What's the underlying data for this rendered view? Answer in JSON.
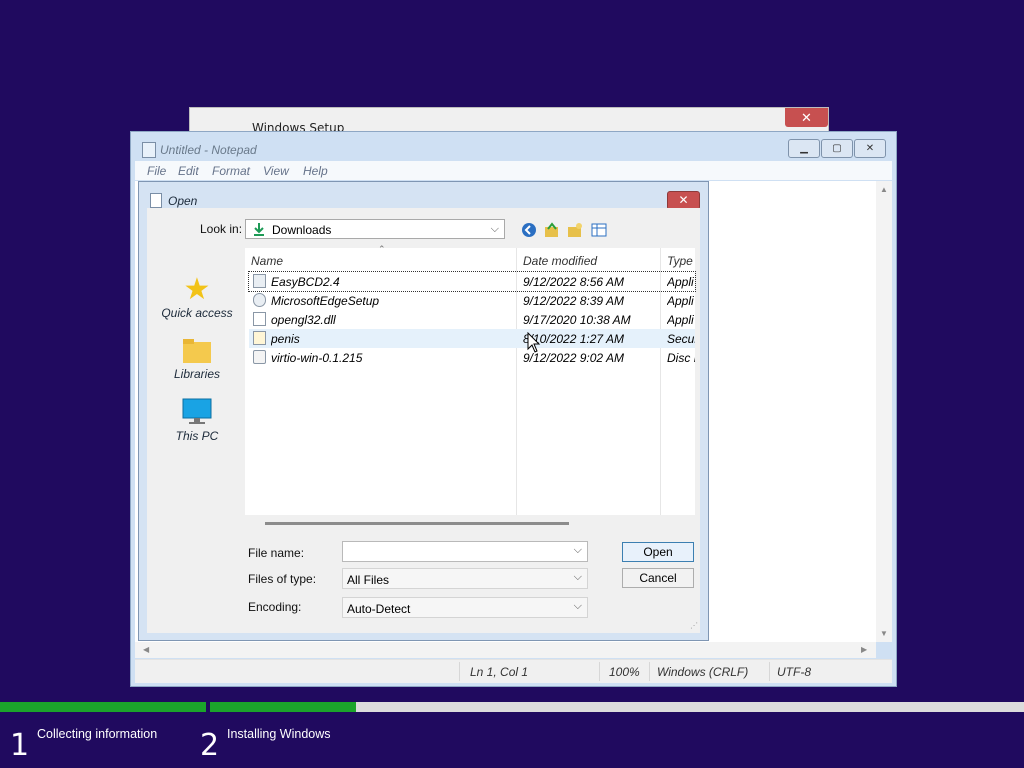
{
  "setup_window": {
    "title": "Windows Setup",
    "close_glyph": "✕"
  },
  "notepad": {
    "title": "Untitled - Notepad",
    "menu": [
      "File",
      "Edit",
      "Format",
      "View",
      "Help"
    ],
    "status": {
      "position": "Ln 1, Col 1",
      "zoom": "100%",
      "line_endings": "Windows (CRLF)",
      "encoding": "UTF-8"
    }
  },
  "open_dialog": {
    "title": "Open",
    "look_in_label": "Look in:",
    "look_in_value": "Downloads",
    "places": [
      "Quick access",
      "Libraries",
      "This PC"
    ],
    "columns": [
      "Name",
      "Date modified",
      "Type"
    ],
    "files": [
      {
        "name": "EasyBCD2.4",
        "date": "9/12/2022 8:56 AM",
        "type": "Appli"
      },
      {
        "name": "MicrosoftEdgeSetup",
        "date": "9/12/2022 8:39 AM",
        "type": "Appli"
      },
      {
        "name": "opengl32.dll",
        "date": "9/17/2020 10:38 AM",
        "type": "Appli"
      },
      {
        "name": "penis",
        "date": "8/10/2022 1:27 AM",
        "type": "Secur"
      },
      {
        "name": "virtio-win-0.1.215",
        "date": "9/12/2022 9:02 AM",
        "type": "Disc I"
      }
    ],
    "file_name_label": "File name:",
    "file_name_value": "",
    "files_of_type_label": "Files of type:",
    "files_of_type_value": "All Files",
    "encoding_label": "Encoding:",
    "encoding_value": "Auto-Detect",
    "open_button": "Open",
    "cancel_button": "Cancel"
  },
  "setup_steps": [
    {
      "number": "1",
      "label": "Collecting information"
    },
    {
      "number": "2",
      "label": "Installing Windows"
    }
  ],
  "colors": {
    "background": "#200a5f",
    "progress": "#1ba42b",
    "close": "#c75050"
  }
}
